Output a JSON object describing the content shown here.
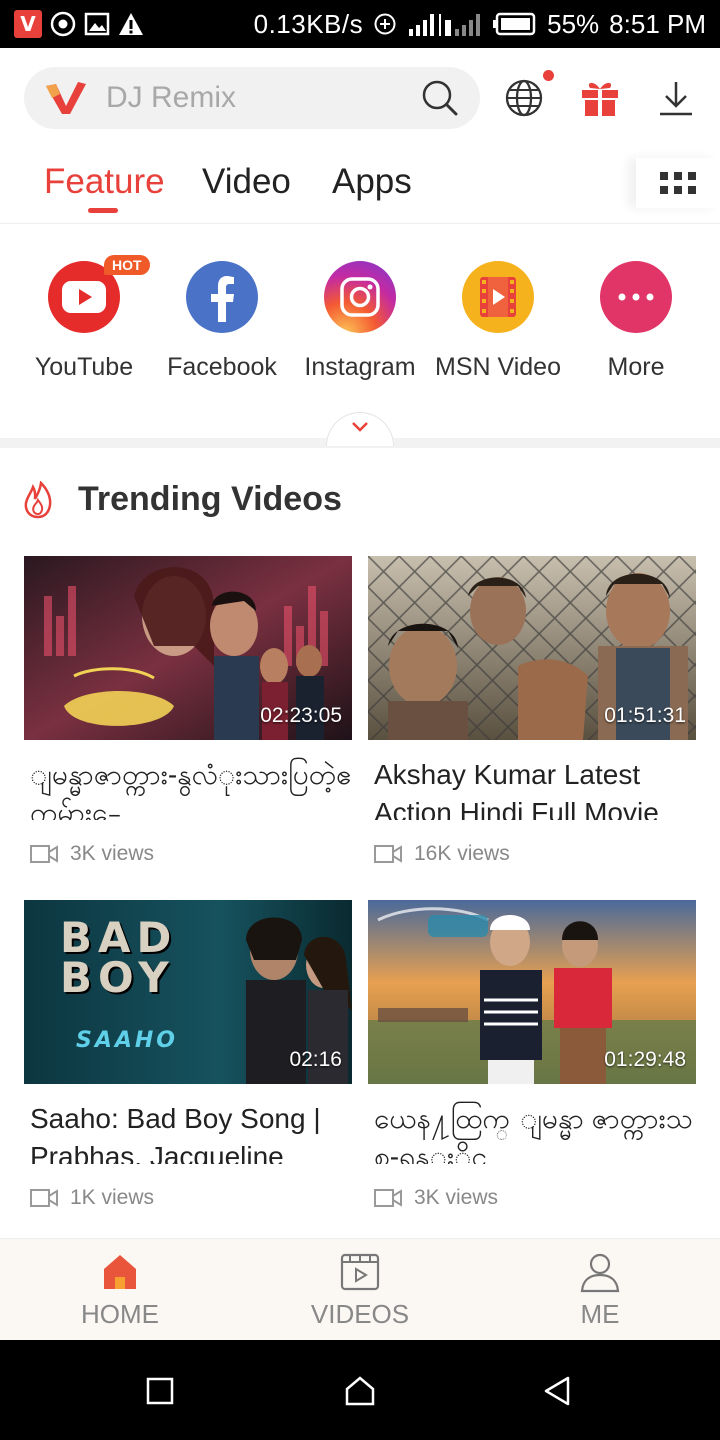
{
  "status_bar": {
    "app_badge": "V",
    "network_speed": "0.13KB/s",
    "battery": "55%",
    "time": "8:51 PM"
  },
  "search": {
    "placeholder": "DJ Remix"
  },
  "tabs": [
    {
      "label": "Feature",
      "active": true
    },
    {
      "label": "Video",
      "active": false
    },
    {
      "label": "Apps",
      "active": false
    }
  ],
  "shortcuts": [
    {
      "label": "YouTube",
      "badge": "HOT",
      "color": "#e62b2b"
    },
    {
      "label": "Facebook",
      "color": "#4a73c8"
    },
    {
      "label": "Instagram",
      "color": "#c32aa3"
    },
    {
      "label": "MSN Video",
      "color": "#f5b21c"
    },
    {
      "label": "More",
      "color": "#e13567"
    }
  ],
  "trending": {
    "title": "Trending Videos",
    "videos": [
      {
        "title": "ျမန္မာဇာတ္ကား-နွလံုးသားပြတဲ့ဧကမ်ား-ေ",
        "duration": "02:23:05",
        "views": "3K views"
      },
      {
        "title": "Akshay Kumar Latest Action Hindi Full Movie",
        "duration": "01:51:31",
        "views": "16K views"
      },
      {
        "title": "Saaho: Bad Boy Song | Prabhas, Jacqueline",
        "duration": "02:16",
        "views": "1K views"
      },
      {
        "title": "ယေန႔ထြက္ ျမန္မာ ဇာတ္ကားသစ္-ရန္ႏိုင္",
        "duration": "01:29:48",
        "views": "3K views"
      }
    ]
  },
  "thumbnail_text": {
    "bad_boy": "BAD BOY",
    "saaho": "SAAHO"
  },
  "bottom_nav": [
    {
      "label": "HOME",
      "active": true
    },
    {
      "label": "VIDEOS",
      "active": false
    },
    {
      "label": "ME",
      "active": false
    }
  ],
  "colors": {
    "accent": "#e8403a",
    "muted": "#888888"
  }
}
